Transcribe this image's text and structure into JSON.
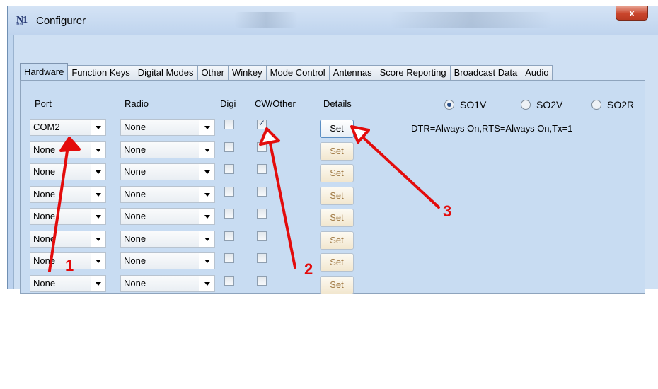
{
  "window": {
    "title": "Configurer",
    "close_glyph": "x",
    "app_icon_text": "N1",
    "app_icon_sub": "MM"
  },
  "tabs": [
    "Hardware",
    "Function Keys",
    "Digital Modes",
    "Other",
    "Winkey",
    "Mode Control",
    "Antennas",
    "Score Reporting",
    "Broadcast Data",
    "Audio"
  ],
  "active_tab": "Hardware",
  "columns": {
    "port": "Port",
    "radio": "Radio",
    "digi": "Digi",
    "cw_other": "CW/Other",
    "details": "Details"
  },
  "rows": [
    {
      "port": "COM2",
      "radio": "None",
      "digi": false,
      "cw_other": true,
      "details": "Set"
    },
    {
      "port": "None",
      "radio": "None",
      "digi": false,
      "cw_other": false,
      "details": "Set"
    },
    {
      "port": "None",
      "radio": "None",
      "digi": false,
      "cw_other": false,
      "details": "Set"
    },
    {
      "port": "None",
      "radio": "None",
      "digi": false,
      "cw_other": false,
      "details": "Set"
    },
    {
      "port": "None",
      "radio": "None",
      "digi": false,
      "cw_other": false,
      "details": "Set"
    },
    {
      "port": "None",
      "radio": "None",
      "digi": false,
      "cw_other": false,
      "details": "Set"
    },
    {
      "port": "None",
      "radio": "None",
      "digi": false,
      "cw_other": false,
      "details": "Set"
    },
    {
      "port": "None",
      "radio": "None",
      "digi": false,
      "cw_other": false,
      "details": "Set"
    }
  ],
  "radios": [
    {
      "label": "SO1V",
      "selected": true
    },
    {
      "label": "SO2V",
      "selected": false
    },
    {
      "label": "SO2R",
      "selected": false
    }
  ],
  "status_text": "DTR=Always On,RTS=Always On,Tx=1",
  "annotations": {
    "color": "#e30c0c",
    "labels": [
      "1",
      "2",
      "3"
    ]
  },
  "colors": {
    "panel": "#c8dcf2",
    "titlebar": "#c8dbf0",
    "close": "#c9452c"
  }
}
